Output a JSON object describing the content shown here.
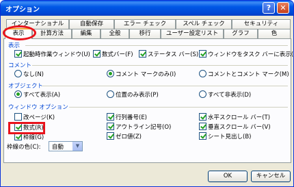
{
  "window": {
    "title": "オプション",
    "help_icon": "?",
    "close_icon": "✕"
  },
  "tabs_top": [
    {
      "label": "インターナショナル"
    },
    {
      "label": "自動保存"
    },
    {
      "label": "エラー チェック"
    },
    {
      "label": "スペル チェック"
    },
    {
      "label": "セキュリティ"
    }
  ],
  "tabs_bottom": [
    {
      "label": "表示"
    },
    {
      "label": "計算方法"
    },
    {
      "label": "編集"
    },
    {
      "label": "全般"
    },
    {
      "label": "移行"
    },
    {
      "label": "ユーザー設定リスト"
    },
    {
      "label": "グラフ"
    },
    {
      "label": "色"
    }
  ],
  "active_tab": "表示",
  "display": {
    "heading": "表示",
    "items": [
      {
        "label": "起動時作業ウィンドウ(U)",
        "checked": true
      },
      {
        "label": "数式バー(F)",
        "checked": true
      },
      {
        "label": "ステータス バー(S)",
        "checked": true
      },
      {
        "label": "ウィンドウをタスク バーに表示(W)",
        "checked": true
      }
    ]
  },
  "comments": {
    "heading": "コメント",
    "items": [
      {
        "label": "なし(N)",
        "checked": false
      },
      {
        "label": "コメント マークのみ(I)",
        "checked": true
      },
      {
        "label": "コメントとコメント マーク(M)",
        "checked": false
      }
    ]
  },
  "objects": {
    "heading": "オブジェクト",
    "items": [
      {
        "label": "すべて表示(A)",
        "checked": true
      },
      {
        "label": "位置のみ表示(P)",
        "checked": false
      },
      {
        "label": "すべて非表示(D)",
        "checked": false
      }
    ]
  },
  "window_options": {
    "heading": "ウィンドウ オプション",
    "col1": [
      {
        "label": "改ページ(K)",
        "checked": false
      },
      {
        "label": "数式(R)",
        "checked": true
      },
      {
        "label": "枠線(G)",
        "checked": true
      }
    ],
    "col2": [
      {
        "label": "行列番号(E)",
        "checked": true
      },
      {
        "label": "アウトライン記号(O)",
        "checked": true
      },
      {
        "label": "ゼロ値(Z)",
        "checked": true
      }
    ],
    "col3": [
      {
        "label": "水平スクロール バー(T)",
        "checked": true
      },
      {
        "label": "垂直スクロール バー(V)",
        "checked": true
      },
      {
        "label": "シート見出し(B)",
        "checked": true
      }
    ],
    "gridline_color_label": "枠線の色(C):",
    "gridline_color_value": "自動"
  },
  "buttons": {
    "ok": "OK",
    "cancel": "キャンセル"
  },
  "colors": {
    "titlebar": "#0058e6",
    "section_heading": "#0046d5",
    "highlight": "#e8141c",
    "check": "#21a121"
  }
}
